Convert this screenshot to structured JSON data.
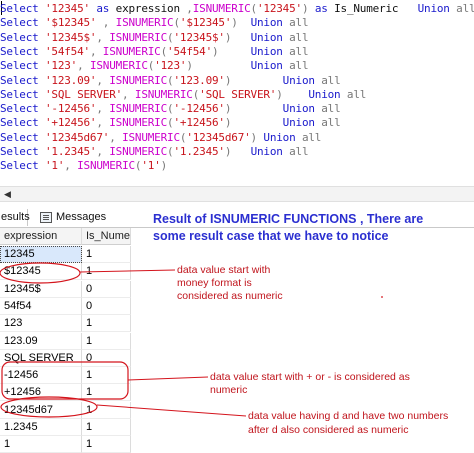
{
  "editor": {
    "lines": [
      [
        {
          "c": "kw",
          "t": "Select "
        },
        {
          "c": "str",
          "t": "'12345'"
        },
        {
          "c": "kw",
          "t": " as "
        },
        {
          "c": "pl",
          "t": "expression "
        },
        {
          "c": "op",
          "t": ","
        },
        {
          "c": "fn",
          "t": "ISNUMERIC"
        },
        {
          "c": "op",
          "t": "("
        },
        {
          "c": "str",
          "t": "'12345'"
        },
        {
          "c": "op",
          "t": ")"
        },
        {
          "c": "kw",
          "t": " as "
        },
        {
          "c": "pl",
          "t": "Is_Numeric   "
        },
        {
          "c": "kw",
          "t": "Union "
        },
        {
          "c": "op",
          "t": "all"
        }
      ],
      [
        {
          "c": "kw",
          "t": "Select "
        },
        {
          "c": "str",
          "t": "'$12345'"
        },
        {
          "c": "op",
          "t": " , "
        },
        {
          "c": "fn",
          "t": "ISNUMERIC"
        },
        {
          "c": "op",
          "t": "("
        },
        {
          "c": "str",
          "t": "'$12345'"
        },
        {
          "c": "op",
          "t": ")  "
        },
        {
          "c": "kw",
          "t": "Union "
        },
        {
          "c": "op",
          "t": "all"
        }
      ],
      [
        {
          "c": "kw",
          "t": "Select "
        },
        {
          "c": "str",
          "t": "'12345$'"
        },
        {
          "c": "op",
          "t": ", "
        },
        {
          "c": "fn",
          "t": "ISNUMERIC"
        },
        {
          "c": "op",
          "t": "("
        },
        {
          "c": "str",
          "t": "'12345$'"
        },
        {
          "c": "op",
          "t": ")   "
        },
        {
          "c": "kw",
          "t": "Union "
        },
        {
          "c": "op",
          "t": "all"
        }
      ],
      [
        {
          "c": "kw",
          "t": "Select "
        },
        {
          "c": "str",
          "t": "'54f54'"
        },
        {
          "c": "op",
          "t": ", "
        },
        {
          "c": "fn",
          "t": "ISNUMERIC"
        },
        {
          "c": "op",
          "t": "("
        },
        {
          "c": "str",
          "t": "'54f54'"
        },
        {
          "c": "op",
          "t": ")     "
        },
        {
          "c": "kw",
          "t": "Union "
        },
        {
          "c": "op",
          "t": "all"
        }
      ],
      [
        {
          "c": "kw",
          "t": "Select "
        },
        {
          "c": "str",
          "t": "'123'"
        },
        {
          "c": "op",
          "t": ", "
        },
        {
          "c": "fn",
          "t": "ISNUMERIC"
        },
        {
          "c": "op",
          "t": "("
        },
        {
          "c": "str",
          "t": "'123'"
        },
        {
          "c": "op",
          "t": ")         "
        },
        {
          "c": "kw",
          "t": "Union "
        },
        {
          "c": "op",
          "t": "all"
        }
      ],
      [
        {
          "c": "kw",
          "t": "Select "
        },
        {
          "c": "str",
          "t": "'123.09'"
        },
        {
          "c": "op",
          "t": ", "
        },
        {
          "c": "fn",
          "t": "ISNUMERIC"
        },
        {
          "c": "op",
          "t": "("
        },
        {
          "c": "str",
          "t": "'123.09'"
        },
        {
          "c": "op",
          "t": ")        "
        },
        {
          "c": "kw",
          "t": "Union "
        },
        {
          "c": "op",
          "t": "all"
        }
      ],
      [
        {
          "c": "kw",
          "t": "Select "
        },
        {
          "c": "str",
          "t": "'SQL SERVER'"
        },
        {
          "c": "op",
          "t": ", "
        },
        {
          "c": "fn",
          "t": "ISNUMERIC"
        },
        {
          "c": "op",
          "t": "("
        },
        {
          "c": "str",
          "t": "'SQL SERVER'"
        },
        {
          "c": "op",
          "t": ")    "
        },
        {
          "c": "kw",
          "t": "Union "
        },
        {
          "c": "op",
          "t": "all"
        }
      ],
      [
        {
          "c": "kw",
          "t": "Select "
        },
        {
          "c": "str",
          "t": "'-12456'"
        },
        {
          "c": "op",
          "t": ", "
        },
        {
          "c": "fn",
          "t": "ISNUMERIC"
        },
        {
          "c": "op",
          "t": "("
        },
        {
          "c": "str",
          "t": "'-12456'"
        },
        {
          "c": "op",
          "t": ")        "
        },
        {
          "c": "kw",
          "t": "Union "
        },
        {
          "c": "op",
          "t": "all"
        }
      ],
      [
        {
          "c": "kw",
          "t": "Select "
        },
        {
          "c": "str",
          "t": "'+12456'"
        },
        {
          "c": "op",
          "t": ", "
        },
        {
          "c": "fn",
          "t": "ISNUMERIC"
        },
        {
          "c": "op",
          "t": "("
        },
        {
          "c": "str",
          "t": "'+12456'"
        },
        {
          "c": "op",
          "t": ")        "
        },
        {
          "c": "kw",
          "t": "Union "
        },
        {
          "c": "op",
          "t": "all"
        }
      ],
      [
        {
          "c": "kw",
          "t": "Select "
        },
        {
          "c": "str",
          "t": "'12345d67'"
        },
        {
          "c": "op",
          "t": ", "
        },
        {
          "c": "fn",
          "t": "ISNUMERIC"
        },
        {
          "c": "op",
          "t": "("
        },
        {
          "c": "str",
          "t": "'12345d67'"
        },
        {
          "c": "op",
          "t": ") "
        },
        {
          "c": "kw",
          "t": "Union "
        },
        {
          "c": "op",
          "t": "all"
        }
      ],
      [
        {
          "c": "kw",
          "t": "Select "
        },
        {
          "c": "str",
          "t": "'1.2345'"
        },
        {
          "c": "op",
          "t": ", "
        },
        {
          "c": "fn",
          "t": "ISNUMERIC"
        },
        {
          "c": "op",
          "t": "("
        },
        {
          "c": "str",
          "t": "'1.2345'"
        },
        {
          "c": "op",
          "t": ")   "
        },
        {
          "c": "kw",
          "t": "Union "
        },
        {
          "c": "op",
          "t": "all"
        }
      ],
      [
        {
          "c": "kw",
          "t": "Select "
        },
        {
          "c": "str",
          "t": "'1'"
        },
        {
          "c": "op",
          "t": ", "
        },
        {
          "c": "fn",
          "t": "ISNUMERIC"
        },
        {
          "c": "op",
          "t": "("
        },
        {
          "c": "str",
          "t": "'1'"
        },
        {
          "c": "op",
          "t": ")"
        }
      ]
    ]
  },
  "tabs": {
    "results_label": "esults",
    "messages_label": "Messages"
  },
  "grid": {
    "columns": [
      "expression",
      "Is_Numeric"
    ],
    "rows": [
      [
        "12345",
        "1"
      ],
      [
        "$12345",
        "1"
      ],
      [
        "12345$",
        "0"
      ],
      [
        "54f54",
        "0"
      ],
      [
        "123",
        "1"
      ],
      [
        "123.09",
        "1"
      ],
      [
        "SQL SERVER",
        "0"
      ],
      [
        "-12456",
        "1"
      ],
      [
        "+12456",
        "1"
      ],
      [
        "12345d67",
        "1"
      ],
      [
        "1.2345",
        "1"
      ],
      [
        "1",
        "1"
      ]
    ]
  },
  "annotations": {
    "title_line1": "Result of ISNUMERIC FUNCTIONS , There are",
    "title_line2": "some result case that we have to notice",
    "note1": [
      "data value start with",
      "money format is",
      "considered as numeric"
    ],
    "note2": [
      "data value start with + or -  is considered as",
      "numeric"
    ],
    "note3": [
      "data value having d and have two numbers",
      "after d  also considered as numeric"
    ]
  },
  "colors": {
    "keyword": "#1a1acc",
    "string": "#c8141c",
    "function": "#cc00cc",
    "annotation_title": "#2b2fd0",
    "annotation_note": "#c0141c"
  }
}
